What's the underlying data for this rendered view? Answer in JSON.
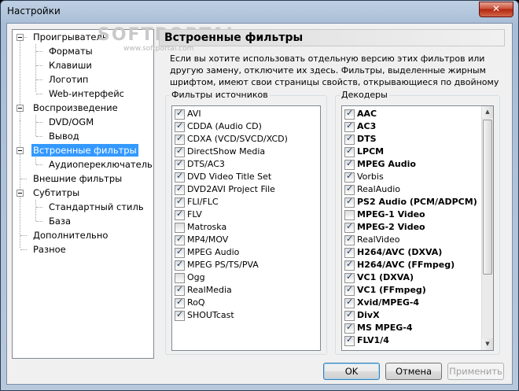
{
  "window": {
    "title": "Настройки",
    "close_label": "✕"
  },
  "watermark": {
    "text": "SOFTPORTAL",
    "url": "www.softportal.com"
  },
  "tree": {
    "items": [
      {
        "label": "Проигрыватель"
      },
      {
        "label": "Форматы"
      },
      {
        "label": "Клавиши"
      },
      {
        "label": "Логотип"
      },
      {
        "label": "Web-интерфейс"
      },
      {
        "label": "Воспроизведение"
      },
      {
        "label": "DVD/OGM"
      },
      {
        "label": "Вывод"
      },
      {
        "label": "Встроенные фильтры"
      },
      {
        "label": "Аудиопереключатель"
      },
      {
        "label": "Внешние фильтры"
      },
      {
        "label": "Субтитры"
      },
      {
        "label": "Стандартный стиль"
      },
      {
        "label": "База"
      },
      {
        "label": "Дополнительно"
      },
      {
        "label": "Разное"
      }
    ]
  },
  "panel": {
    "title": "Встроенные фильтры",
    "description": "Если вы хотите использовать отдельную версию этих фильтров или другую замену, отключите их здесь. Фильтры, выделенные жирным шрифтом, имеют свои страницы свойств, открывающиеся по двойному клику.",
    "sources_label": "Фильтры источников",
    "decoders_label": "Декодеры",
    "sources": [
      {
        "label": "AVI",
        "checked": true
      },
      {
        "label": "CDDA (Audio CD)",
        "checked": true
      },
      {
        "label": "CDXA (VCD/SVCD/XCD)",
        "checked": true
      },
      {
        "label": "DirectShow Media",
        "checked": true
      },
      {
        "label": "DTS/AC3",
        "checked": true
      },
      {
        "label": "DVD Video Title Set",
        "checked": true
      },
      {
        "label": "DVD2AVI Project File",
        "checked": true
      },
      {
        "label": "FLI/FLC",
        "checked": true
      },
      {
        "label": "FLV",
        "checked": true
      },
      {
        "label": "Matroska",
        "checked": false
      },
      {
        "label": "MP4/MOV",
        "checked": true
      },
      {
        "label": "MPEG Audio",
        "checked": true
      },
      {
        "label": "MPEG PS/TS/PVA",
        "checked": true
      },
      {
        "label": "Ogg",
        "checked": false
      },
      {
        "label": "RealMedia",
        "checked": true
      },
      {
        "label": "RoQ",
        "checked": true
      },
      {
        "label": "SHOUTcast",
        "checked": true
      }
    ],
    "decoders": [
      {
        "label": "AAC",
        "checked": true,
        "bold": true
      },
      {
        "label": "AC3",
        "checked": true,
        "bold": true
      },
      {
        "label": "DTS",
        "checked": true,
        "bold": true
      },
      {
        "label": "LPCM",
        "checked": true,
        "bold": true
      },
      {
        "label": "MPEG Audio",
        "checked": true,
        "bold": true
      },
      {
        "label": "Vorbis",
        "checked": true,
        "bold": false
      },
      {
        "label": "RealAudio",
        "checked": true,
        "bold": false
      },
      {
        "label": "PS2 Audio (PCM/ADPCM)",
        "checked": true,
        "bold": true
      },
      {
        "label": "MPEG-1 Video",
        "checked": false,
        "bold": true
      },
      {
        "label": "MPEG-2 Video",
        "checked": true,
        "bold": true
      },
      {
        "label": "RealVideo",
        "checked": true,
        "bold": false
      },
      {
        "label": "H264/AVC (DXVA)",
        "checked": true,
        "bold": true
      },
      {
        "label": "H264/AVC (FFmpeg)",
        "checked": true,
        "bold": true
      },
      {
        "label": "VC1 (DXVA)",
        "checked": true,
        "bold": true
      },
      {
        "label": "VC1 (FFmpeg)",
        "checked": true,
        "bold": true
      },
      {
        "label": "Xvid/MPEG-4",
        "checked": true,
        "bold": true
      },
      {
        "label": "DivX",
        "checked": true,
        "bold": true
      },
      {
        "label": "MS MPEG-4",
        "checked": true,
        "bold": true
      },
      {
        "label": "FLV1/4",
        "checked": true,
        "bold": true
      }
    ]
  },
  "buttons": {
    "ok": "OK",
    "cancel": "Отмена",
    "apply": "Применить"
  }
}
